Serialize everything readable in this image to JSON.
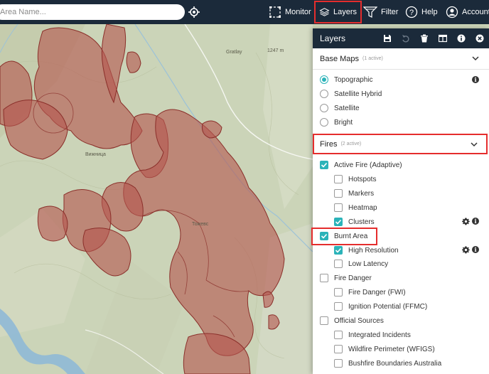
{
  "topbar": {
    "search_placeholder": "Area Name...",
    "nav": [
      {
        "label": "Monitor",
        "icon": "monitor-icon"
      },
      {
        "label": "Layers",
        "icon": "layers-icon"
      },
      {
        "label": "Filter",
        "icon": "filter-icon"
      },
      {
        "label": "Help",
        "icon": "help-icon"
      },
      {
        "label": "Account",
        "icon": "account-icon"
      }
    ]
  },
  "map": {
    "labels": [
      "Gratlay",
      "1247 m",
      "Вижница",
      "Тожевс"
    ]
  },
  "panel": {
    "title": "Layers",
    "base_maps": {
      "title": "Base Maps",
      "count": "(1 active)",
      "options": [
        "Topographic",
        "Satellite Hybrid",
        "Satellite",
        "Bright"
      ],
      "selected": "Topographic"
    },
    "fires": {
      "title": "Fires",
      "count": "(2 active)",
      "items": {
        "active_fire": "Active Fire (Adaptive)",
        "hotspots": "Hotspots",
        "markers": "Markers",
        "heatmap": "Heatmap",
        "clusters": "Clusters",
        "burnt_area": "Burnt Area",
        "high_resolution": "High Resolution",
        "low_latency": "Low Latency",
        "fire_danger": "Fire Danger",
        "fire_danger_fwi": "Fire Danger (FWI)",
        "ignition_potential": "Ignition Potential (FFMC)",
        "official_sources": "Official Sources",
        "integrated_incidents": "Integrated Incidents",
        "wfigs": "Wildfire Perimeter (WFIGS)",
        "bushfire": "Bushfire Boundaries Australia"
      }
    }
  },
  "colors": {
    "accent": "#2bb3b9",
    "highlight": "#e52d2d",
    "topbar": "#1b2a3a",
    "burn_fill": "#b5574f"
  }
}
